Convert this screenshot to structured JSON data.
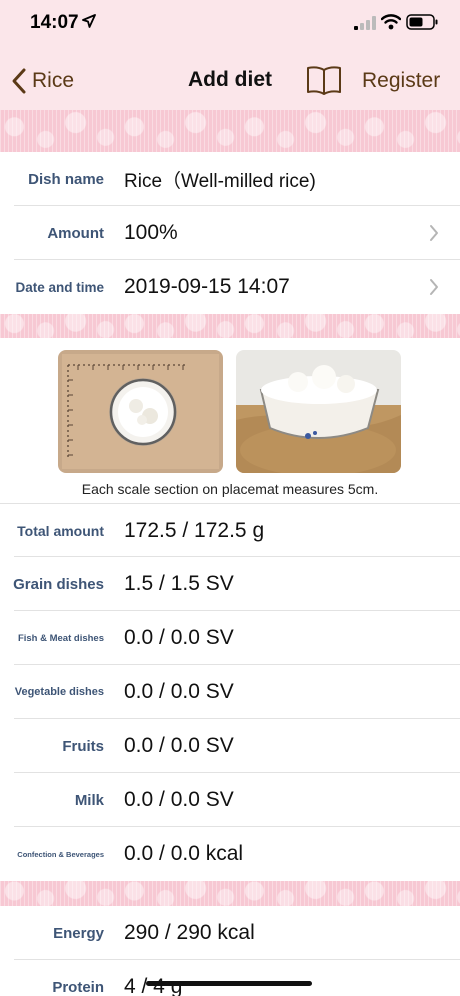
{
  "status": {
    "time": "14:07"
  },
  "nav": {
    "back_label": "Rice",
    "title": "Add diet",
    "register_label": "Register"
  },
  "dish": {
    "name_label": "Dish name",
    "name_value": "Rice（Well-milled rice)",
    "amount_label": "Amount",
    "amount_value": "100%",
    "datetime_label": "Date and time",
    "datetime_value": "2019-09-15 14:07"
  },
  "photos": {
    "caption": "Each scale section on placemat measures 5cm."
  },
  "nutrition": [
    {
      "label": "Total amount",
      "value": "172.5 / 172.5 g"
    },
    {
      "label": "Grain dishes",
      "value": "1.5 / 1.5 SV"
    },
    {
      "label": "Fish & Meat dishes",
      "value": "0.0 / 0.0 SV"
    },
    {
      "label": "Vegetable dishes",
      "value": "0.0 / 0.0 SV"
    },
    {
      "label": "Fruits",
      "value": "0.0 / 0.0 SV"
    },
    {
      "label": "Milk",
      "value": "0.0 / 0.0 SV"
    },
    {
      "label": "Confection & Beverages",
      "value": "0.0 / 0.0 kcal"
    }
  ],
  "energy": [
    {
      "label": "Energy",
      "value": "290 / 290 kcal"
    },
    {
      "label": "Protein",
      "value": "4 / 4 g"
    }
  ],
  "colors": {
    "header_bg": "#fbe6ea",
    "band": "#f7c8d3",
    "label": "#3e5576",
    "accent": "#5b3a17"
  }
}
